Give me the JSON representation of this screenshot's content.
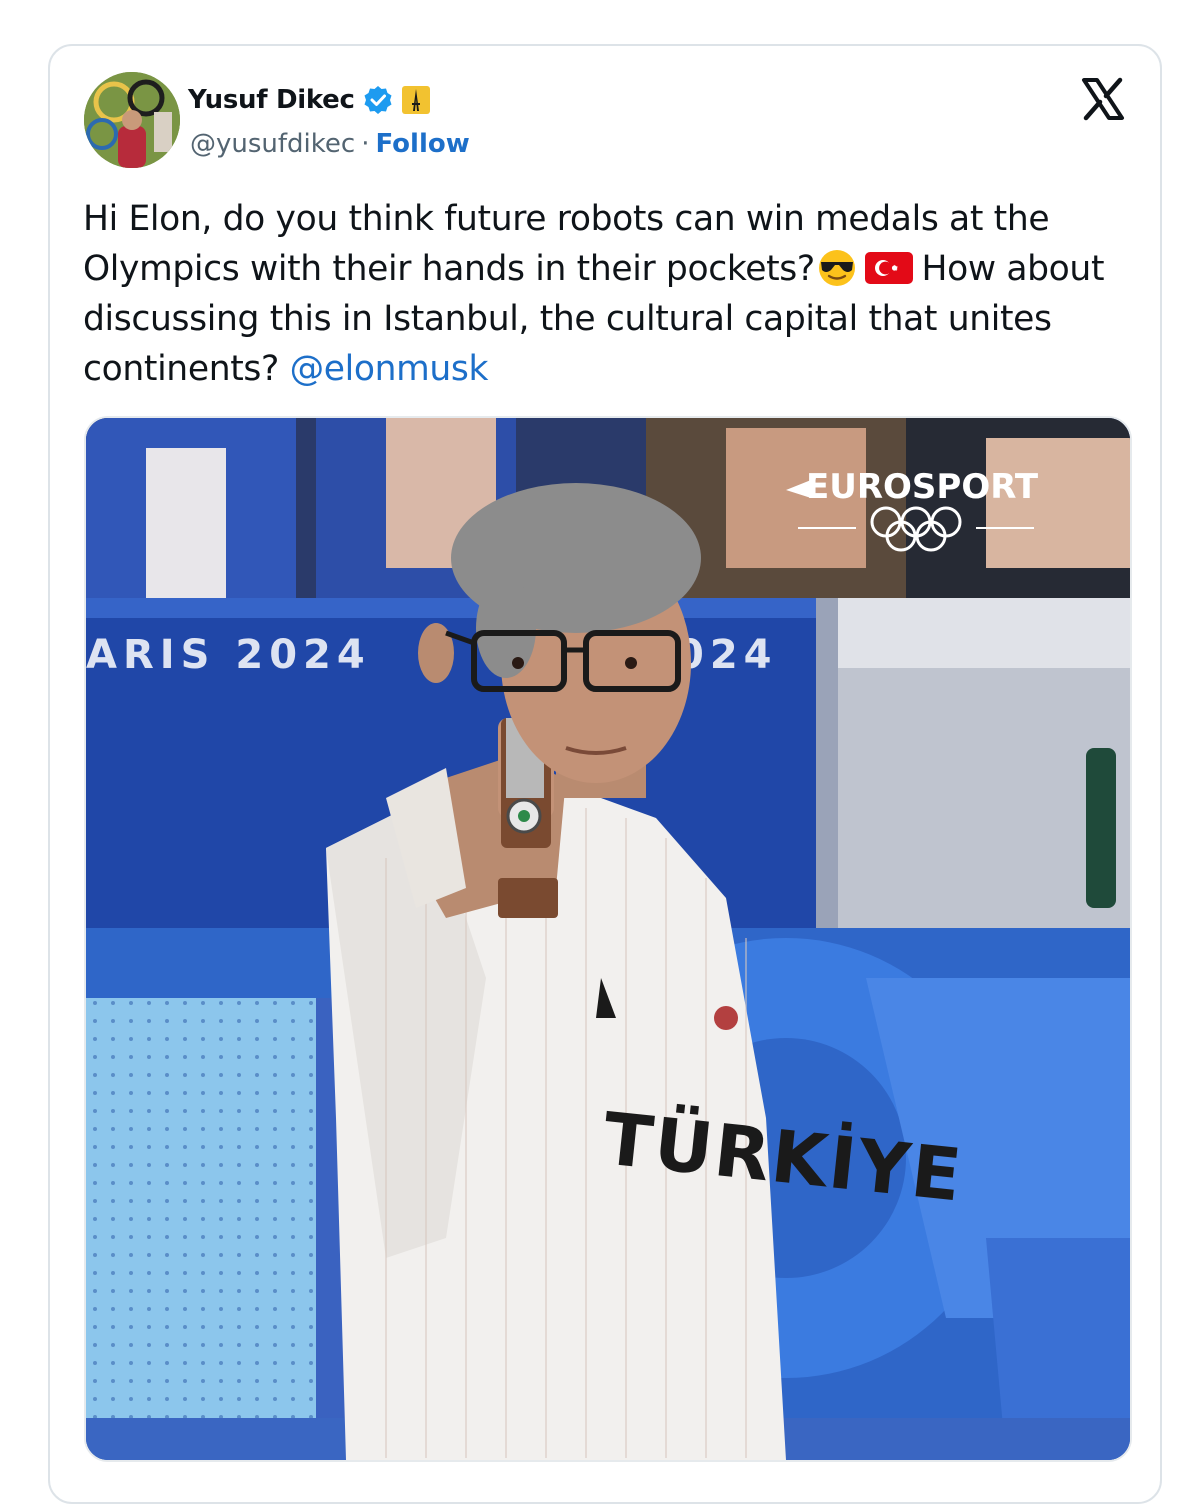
{
  "tweet": {
    "display_name": "Yusuf Dikec",
    "handle": "@yusufdikec",
    "separator": "·",
    "follow_label": "Follow",
    "text_part1": "Hi Elon, do you think future robots can win medals at the Olympics with their hands in their pockets?",
    "text_part2": " How about discussing this in Istanbul, the cultural capital that unites continents? ",
    "mention": "@elonmusk"
  },
  "icons": {
    "verified": "verified-badge-icon",
    "affiliation": "affiliation-badge-icon",
    "platform": "x-logo-icon",
    "emoji_1": "sunglasses-emoji",
    "emoji_2": "turkey-flag-emoji"
  },
  "media": {
    "broadcaster_logo": "EUROSPORT",
    "banner_left": "ARIS 2024",
    "banner_right": "024",
    "shirt_text": "TÜRKİYE"
  },
  "colors": {
    "link": "#1d6fc9",
    "verified": "#1d9bf0",
    "text": "#0f1419",
    "secondary": "#536471"
  }
}
